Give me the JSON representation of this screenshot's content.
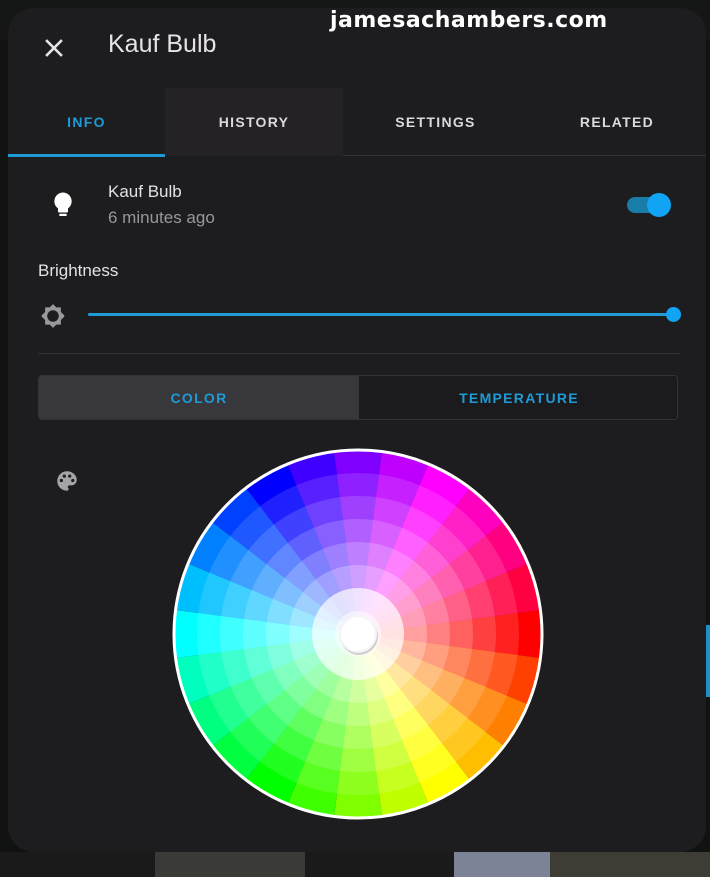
{
  "watermark": "jamesachambers.com",
  "dialog": {
    "title": "Kauf Bulb",
    "close_icon": "close-icon"
  },
  "tabs": [
    {
      "label": "INFO",
      "active": true
    },
    {
      "label": "HISTORY",
      "active": false
    },
    {
      "label": "SETTINGS",
      "active": false
    },
    {
      "label": "RELATED",
      "active": false
    }
  ],
  "entity": {
    "icon": "lightbulb-icon",
    "name": "Kauf Bulb",
    "last_changed": "6 minutes ago",
    "state_on": true
  },
  "brightness": {
    "label": "Brightness",
    "icon": "brightness-icon",
    "value_percent": 100
  },
  "mode_toggle": {
    "options": [
      "COLOR",
      "TEMPERATURE"
    ],
    "selected": "COLOR"
  },
  "color_picker": {
    "palette_icon": "palette-icon",
    "hue_segments": 24,
    "saturation_rings": 8,
    "selected_color": "#ffffff"
  },
  "colors": {
    "accent": "#1e9bd7",
    "switch_thumb": "#11a4f4",
    "switch_track": "#1a7ca8",
    "dialog_bg": "#1d1c1f",
    "primary_text": "#e4e1e6",
    "secondary_text": "#9a979c"
  }
}
